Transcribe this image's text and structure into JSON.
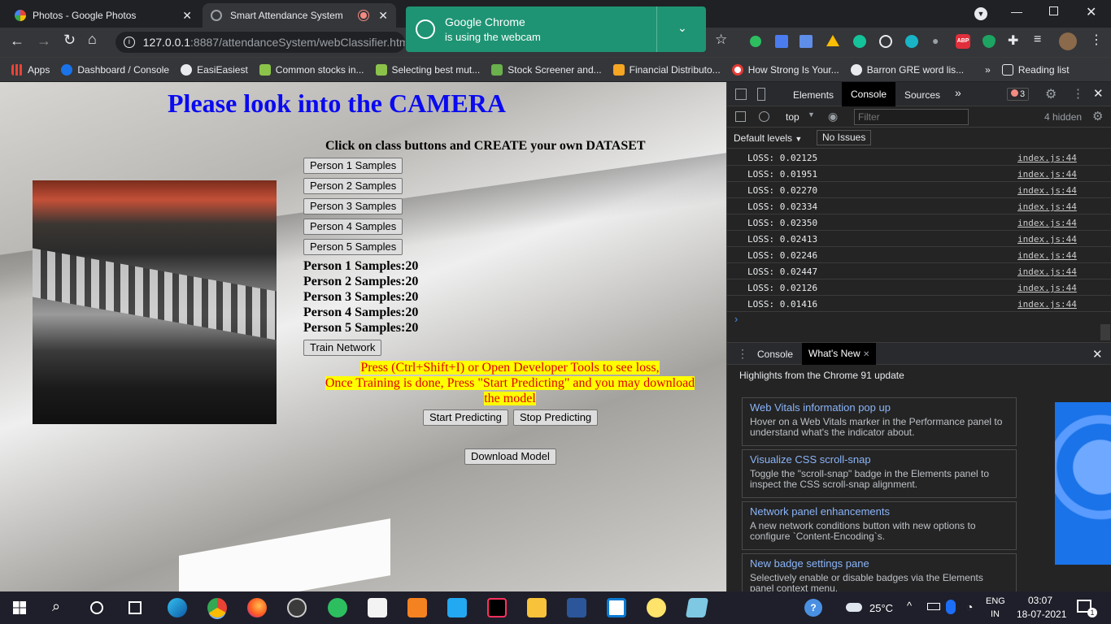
{
  "tabs": [
    {
      "title": "Photos - Google Photos"
    },
    {
      "title": "Smart Attendance System"
    }
  ],
  "webcam_popup": {
    "line1": "Google Chrome",
    "line2": "is using the webcam"
  },
  "url": {
    "host": "127.0.0.1",
    "path": ":8887/attendanceSystem/webClassifier.html"
  },
  "bookmarks": [
    "Apps",
    "Dashboard / Console",
    "EasiEasiest",
    "Common stocks in...",
    "Selecting best mut...",
    "Stock Screener and...",
    "Financial Distributo...",
    "How Strong Is Your...",
    "Barron GRE word lis...",
    "Reading list"
  ],
  "page": {
    "heading": "Please look into the CAMERA",
    "subheading": "Click on class buttons and CREATE your own DATASET",
    "sample_buttons": [
      "Person 1 Samples",
      "Person 2 Samples",
      "Person 3 Samples",
      "Person 4 Samples",
      "Person 5 Samples"
    ],
    "counts": [
      "Person 1 Samples:20",
      "Person 2 Samples:20",
      "Person 3 Samples:20",
      "Person 4 Samples:20",
      "Person 5 Samples:20"
    ],
    "train_button": "Train Network",
    "notice_line1": "Press (Ctrl+Shift+I) or Open Developer Tools to see loss,",
    "notice_line2": "Once Training is done, Press \"Start Predicting\" and you may download",
    "notice_line3": "the model",
    "start_button": "Start Predicting",
    "stop_button": "Stop Predicting",
    "download_button": "Download Model"
  },
  "devtools": {
    "tabs": [
      "Elements",
      "Console",
      "Sources"
    ],
    "error_count": "3",
    "context": "top",
    "filter_placeholder": "Filter",
    "hidden": "4 hidden",
    "levels": "Default levels",
    "issues": "No Issues",
    "logs": [
      {
        "text": "LOSS: 0.02125",
        "src": "index.js:44"
      },
      {
        "text": "LOSS: 0.01951",
        "src": "index.js:44"
      },
      {
        "text": "LOSS: 0.02270",
        "src": "index.js:44"
      },
      {
        "text": "LOSS: 0.02334",
        "src": "index.js:44"
      },
      {
        "text": "LOSS: 0.02350",
        "src": "index.js:44"
      },
      {
        "text": "LOSS: 0.02413",
        "src": "index.js:44"
      },
      {
        "text": "LOSS: 0.02246",
        "src": "index.js:44"
      },
      {
        "text": "LOSS: 0.02447",
        "src": "index.js:44"
      },
      {
        "text": "LOSS: 0.02126",
        "src": "index.js:44"
      },
      {
        "text": "LOSS: 0.01416",
        "src": "index.js:44"
      }
    ],
    "drawer_tabs": [
      "Console",
      "What's New"
    ],
    "highlights": "Highlights from the Chrome 91 update",
    "cards": [
      {
        "title": "Web Vitals information pop up",
        "desc": "Hover on a Web Vitals marker in the Performance panel to understand what's the indicator about."
      },
      {
        "title": "Visualize CSS scroll-snap",
        "desc": "Toggle the \"scroll-snap\" badge in the Elements panel to inspect the CSS scroll-snap alignment."
      },
      {
        "title": "Network panel enhancements",
        "desc": "A new network conditions button with new options to configure `Content-Encoding`s."
      },
      {
        "title": "New badge settings pane",
        "desc": "Selectively enable or disable badges via the Elements panel context menu."
      }
    ]
  },
  "taskbar": {
    "temp": "25°C",
    "lang1": "ENG",
    "lang2": "IN",
    "time": "03:07",
    "date": "18-07-2021",
    "notif": "1"
  }
}
